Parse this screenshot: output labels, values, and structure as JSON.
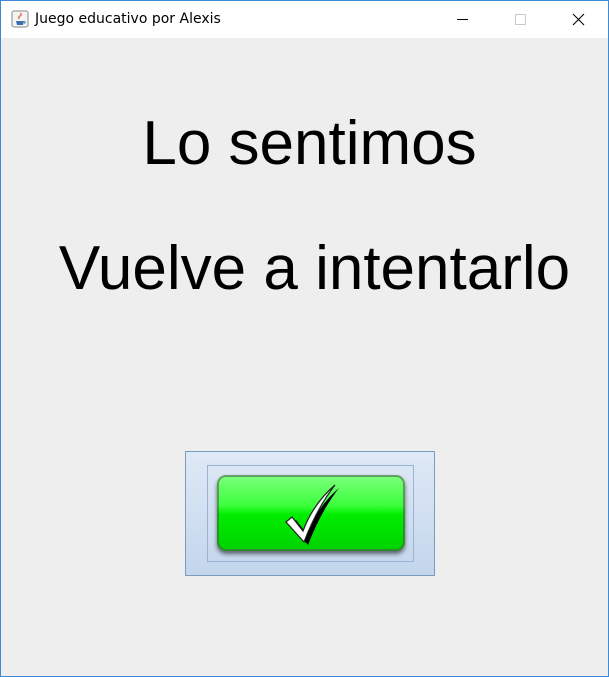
{
  "window": {
    "title": "Juego educativo por Alexis",
    "icon": "java-cup-icon",
    "controls": [
      "minimize-icon",
      "maximize-icon",
      "close-icon"
    ]
  },
  "message": {
    "line1": "Lo sentimos",
    "line2": "Vuelve a intentarlo"
  },
  "button": {
    "icon": "checkmark-icon",
    "colors": {
      "green": "#00ee00",
      "frame": "#c3d6ec"
    }
  }
}
